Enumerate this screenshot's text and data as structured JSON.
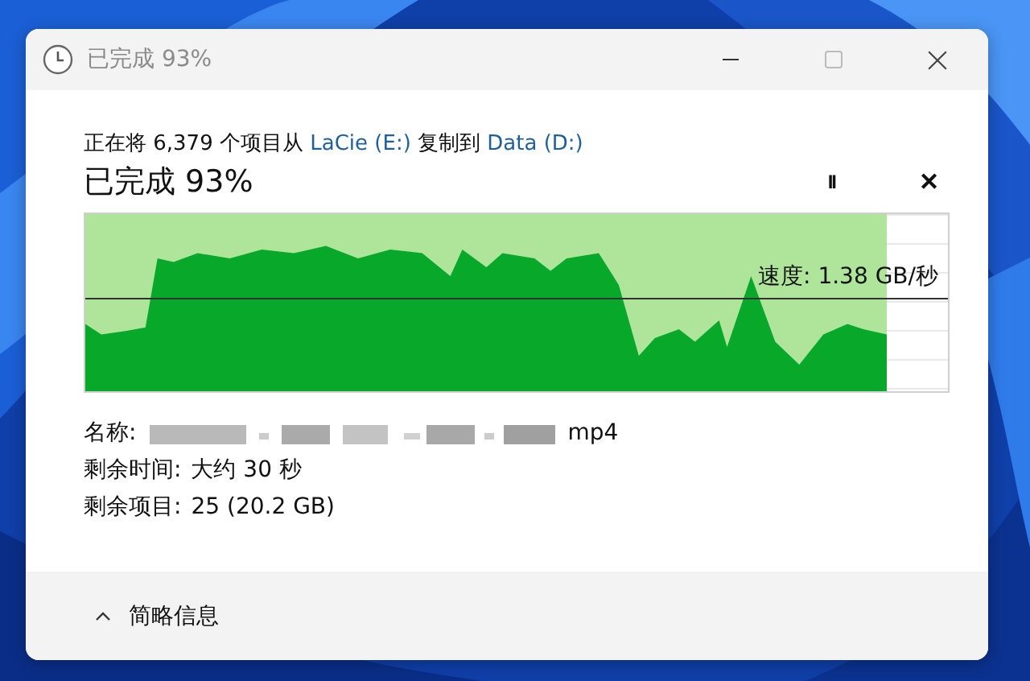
{
  "window": {
    "title": "已完成 93%"
  },
  "header": {
    "prefix": "正在将 6,379 个项目从",
    "source": "LaCie (E:)",
    "middle": "复制到",
    "destination": "Data (D:)"
  },
  "status": "已完成 93%",
  "controls": [
    {
      "kind": "pause",
      "symbol": "II"
    },
    {
      "kind": "cancel",
      "symbol": "✕"
    }
  ],
  "progress": {
    "level": 0.93,
    "speed": "速度: 1.38 GB/秒"
  },
  "details": [
    {
      "kind": "name",
      "label": "名称:",
      "value": "mp4"
    },
    {
      "kind": "text",
      "label": "剩余时间:",
      "value": "大约 30 秒"
    },
    {
      "kind": "text",
      "label": "剩余项目:",
      "value": "25 (20.2 GB)"
    }
  ],
  "footer": {
    "expanded": true,
    "label": "简略信息"
  }
}
